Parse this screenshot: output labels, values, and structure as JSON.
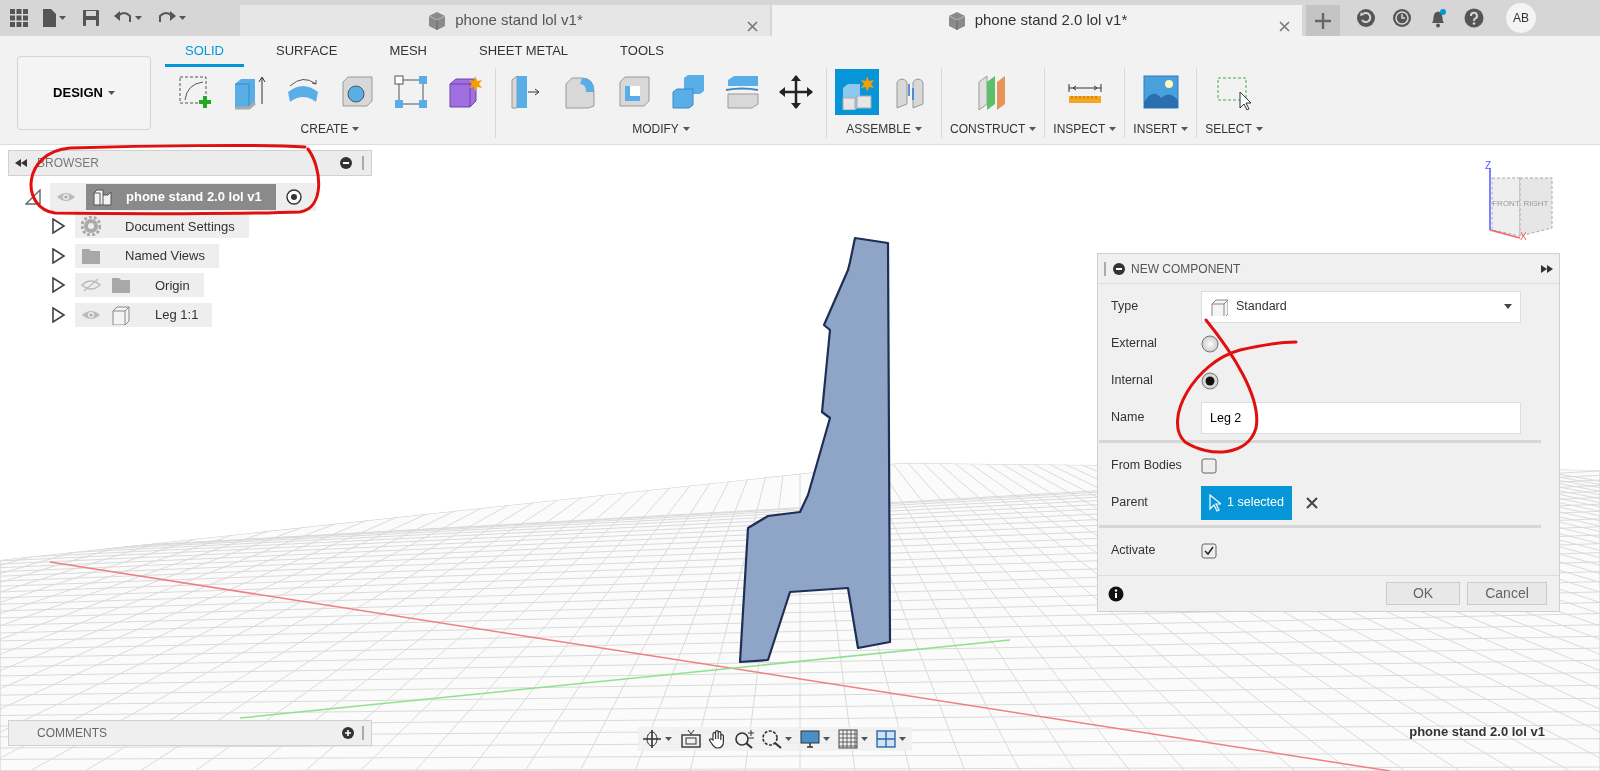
{
  "doc_tabs": [
    {
      "title": "phone stand lol v1*",
      "selected": false
    },
    {
      "title": "phone stand 2.0 lol v1*",
      "selected": true
    }
  ],
  "user": {
    "initials": "AB"
  },
  "ribbon": {
    "workspace": "DESIGN",
    "tabs": [
      {
        "label": "SOLID",
        "selected": true
      },
      {
        "label": "SURFACE",
        "selected": false
      },
      {
        "label": "MESH",
        "selected": false
      },
      {
        "label": "SHEET METAL",
        "selected": false
      },
      {
        "label": "TOOLS",
        "selected": false
      }
    ],
    "groups": [
      {
        "label": "CREATE",
        "tools": [
          {
            "selected": false
          },
          {
            "selected": false
          },
          {
            "selected": false
          },
          {
            "selected": false
          },
          {
            "selected": false
          },
          {
            "selected": false
          }
        ]
      },
      {
        "label": "MODIFY",
        "tools": [
          {
            "selected": false
          },
          {
            "selected": false
          },
          {
            "selected": false
          },
          {
            "selected": false
          },
          {
            "selected": false
          },
          {
            "selected": false
          }
        ]
      },
      {
        "label": "ASSEMBLE",
        "tools": [
          {
            "selected": true
          },
          {
            "selected": false
          }
        ]
      },
      {
        "label": "CONSTRUCT",
        "tools": [
          {
            "selected": false
          }
        ]
      },
      {
        "label": "INSPECT",
        "tools": [
          {
            "selected": false
          }
        ]
      },
      {
        "label": "INSERT",
        "tools": [
          {
            "selected": false
          }
        ]
      },
      {
        "label": "SELECT",
        "tools": [
          {
            "selected": false
          }
        ]
      }
    ]
  },
  "browser": {
    "title": "BROWSER",
    "root": {
      "label": "phone stand 2.0 lol v1",
      "visible": true,
      "expanded": true,
      "children": [
        {
          "label": "Document Settings",
          "kind": "settings",
          "expanded": false
        },
        {
          "label": "Named Views",
          "kind": "folder",
          "expanded": false
        },
        {
          "label": "Origin",
          "kind": "folder",
          "visible": false,
          "expanded": false
        },
        {
          "label": "Leg 1:1",
          "kind": "component",
          "visible": true,
          "expanded": false
        }
      ]
    }
  },
  "view_cube": {
    "faces": [
      "FRONT",
      "RIGHT"
    ],
    "axes": [
      "Z",
      "X"
    ]
  },
  "dialog": {
    "title": "NEW COMPONENT",
    "fields": [
      {
        "kind": "select",
        "label": "Type",
        "value": "Standard"
      },
      {
        "kind": "radio",
        "label": "External",
        "checked": false
      },
      {
        "kind": "radio",
        "label": "Internal",
        "checked": true
      },
      {
        "kind": "text",
        "label": "Name",
        "value": "Leg 2"
      },
      {
        "kind": "divider"
      },
      {
        "kind": "checkbox",
        "label": "From Bodies",
        "checked": false
      },
      {
        "kind": "selection",
        "label": "Parent",
        "value": "1 selected"
      },
      {
        "kind": "divider"
      },
      {
        "kind": "checkbox",
        "label": "Activate",
        "checked": true
      }
    ],
    "buttons": [
      "OK",
      "Cancel"
    ]
  },
  "comments": {
    "title": "COMMENTS"
  },
  "status": {
    "document": "phone stand 2.0 lol v1"
  }
}
